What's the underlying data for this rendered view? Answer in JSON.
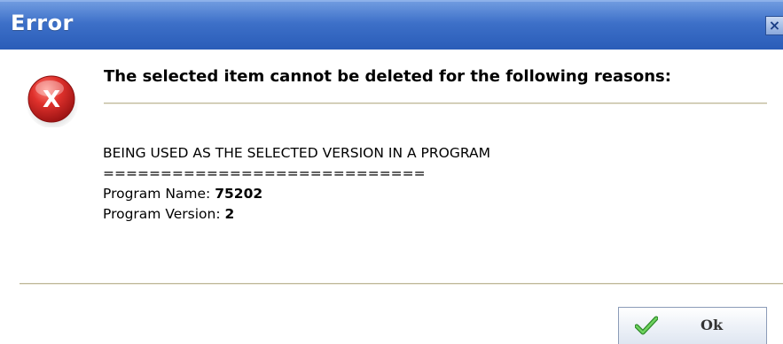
{
  "window": {
    "title": "Error",
    "close_glyph": "×"
  },
  "icons": {
    "error": "error-x-circle-icon",
    "error_glyph": "X",
    "ok": "checkmark-icon"
  },
  "message": {
    "heading": "The selected item cannot be deleted for the following reasons:",
    "reason": "BEING USED AS THE SELECTED VERSION IN A PROGRAM",
    "separator": "============================",
    "program_name_label": "Program Name:",
    "program_name_value": "75202",
    "program_version_label": "Program Version:",
    "program_version_value": "2"
  },
  "buttons": {
    "ok_label": "Ok"
  },
  "colors": {
    "titlebar": "#3d70c8",
    "error_red": "#d42a2a",
    "check_green": "#3fa63a"
  }
}
